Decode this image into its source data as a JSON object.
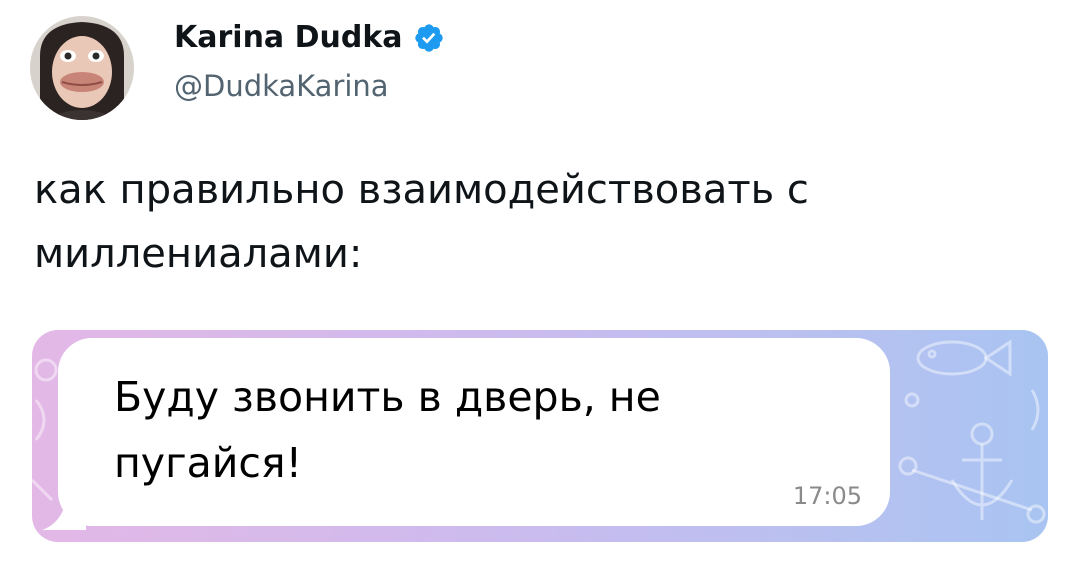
{
  "tweet": {
    "author": {
      "display_name": "Karina Dudka",
      "handle": "@DudkaKarina",
      "verified": true
    },
    "text_line1": "как правильно взаимодействовать с",
    "text_line2": "миллениалами:",
    "media": {
      "message_line1": "Буду звонить в дверь, не",
      "message_line2": "пугайся!",
      "time": "17:05"
    }
  },
  "colors": {
    "verified_badge": "#1d9bf0",
    "handle": "#536471",
    "text": "#0f1419",
    "chat_bg_left": "#e3b8e6",
    "chat_bg_right": "#a9c4f2"
  },
  "icons": {
    "verified": "verified-badge-icon"
  }
}
